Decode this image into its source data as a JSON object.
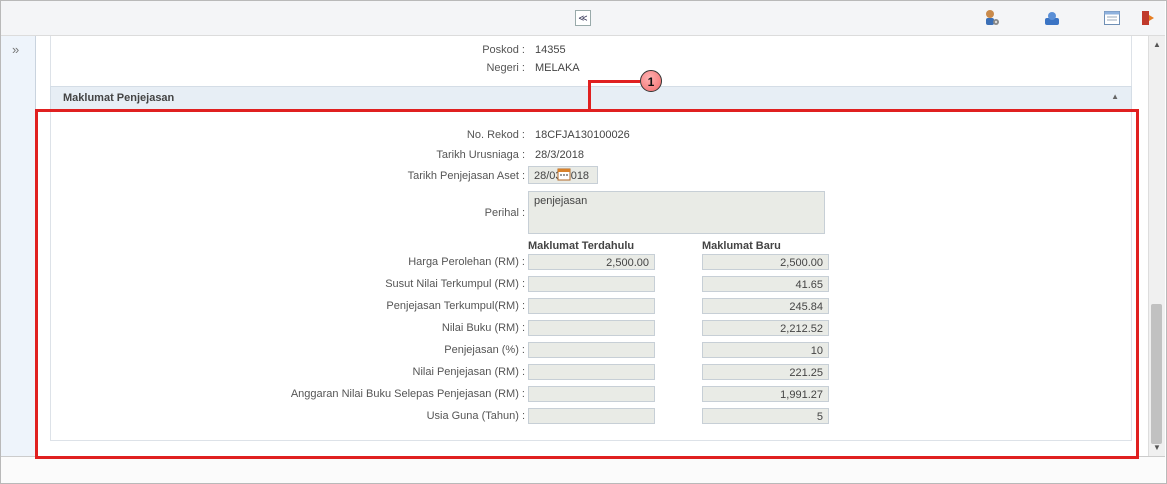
{
  "toolbar": {
    "collapse_glyph": "≪",
    "icons": [
      "user-settings-icon",
      "user-profile-icon",
      "window-icon",
      "logout-icon"
    ]
  },
  "sidebar": {
    "expand_glyph": "»"
  },
  "address": {
    "poskod_label": "Poskod :",
    "poskod_value": "14355",
    "negeri_label": "Negeri :",
    "negeri_value": "MELAKA"
  },
  "section": {
    "title": "Maklumat Penjejasan"
  },
  "callout": {
    "number": "1"
  },
  "record": {
    "no_rekod_label": "No. Rekod :",
    "no_rekod_value": "18CFJA130100026",
    "tarikh_urusniaga_label": "Tarikh Urusniaga :",
    "tarikh_urusniaga_value": "28/3/2018",
    "tarikh_penjejasan_label": "Tarikh Penjejasan Aset :",
    "tarikh_penjejasan_value": "28/03/2018",
    "perihal_label": "Perihal :",
    "perihal_value": "penjejasan"
  },
  "table": {
    "col_prev": "Maklumat Terdahulu",
    "col_new": "Maklumat Baru",
    "rows": [
      {
        "label": "Harga Perolehan (RM) :",
        "prev": "2,500.00",
        "new": "2,500.00"
      },
      {
        "label": "Susut Nilai Terkumpul (RM) :",
        "prev": "",
        "new": "41.65"
      },
      {
        "label": "Penjejasan Terkumpul(RM) :",
        "prev": "",
        "new": "245.84"
      },
      {
        "label": "Nilai Buku (RM) :",
        "prev": "",
        "new": "2,212.52"
      },
      {
        "label": "Penjejasan (%) :",
        "prev": "",
        "new": "10"
      },
      {
        "label": "Nilai Penjejasan (RM) :",
        "prev": "",
        "new": "221.25"
      },
      {
        "label": "Anggaran Nilai Buku Selepas Penjejasan (RM) :",
        "prev": "",
        "new": "1,991.27"
      },
      {
        "label": "Usia Guna (Tahun) :",
        "prev": "",
        "new": "5"
      }
    ]
  },
  "colors": {
    "highlight": "#e02020",
    "section_bg": "#e7eef5",
    "field_bg": "#e9ebe6"
  }
}
